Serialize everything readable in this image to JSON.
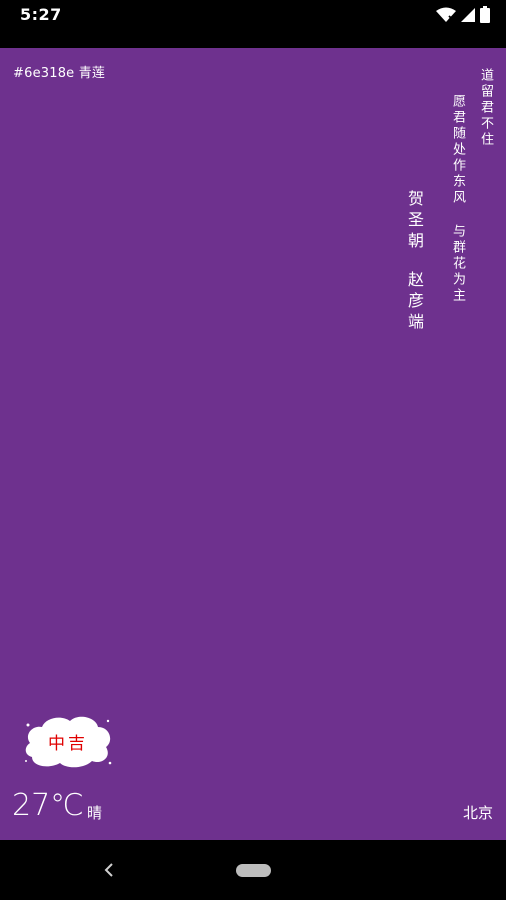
{
  "status_bar": {
    "time": "5:27",
    "icons": [
      "wifi-icon",
      "signal-icon",
      "battery-icon"
    ]
  },
  "colors": {
    "background": "#6e318e",
    "badge_text": "#e00000"
  },
  "color_info": {
    "label": "#6e318e 青莲"
  },
  "poem": {
    "line1": "道留君不住",
    "line2_part1": "愿君随处作东风",
    "line2_part2": "与群花为主",
    "title": "贺圣朝",
    "author": "赵彦端"
  },
  "fortune": {
    "text": "中吉"
  },
  "weather": {
    "temperature": "27℃",
    "condition": "晴",
    "city": "北京"
  },
  "nav_bar": {
    "icons": [
      "back-icon",
      "home-pill-icon"
    ]
  }
}
